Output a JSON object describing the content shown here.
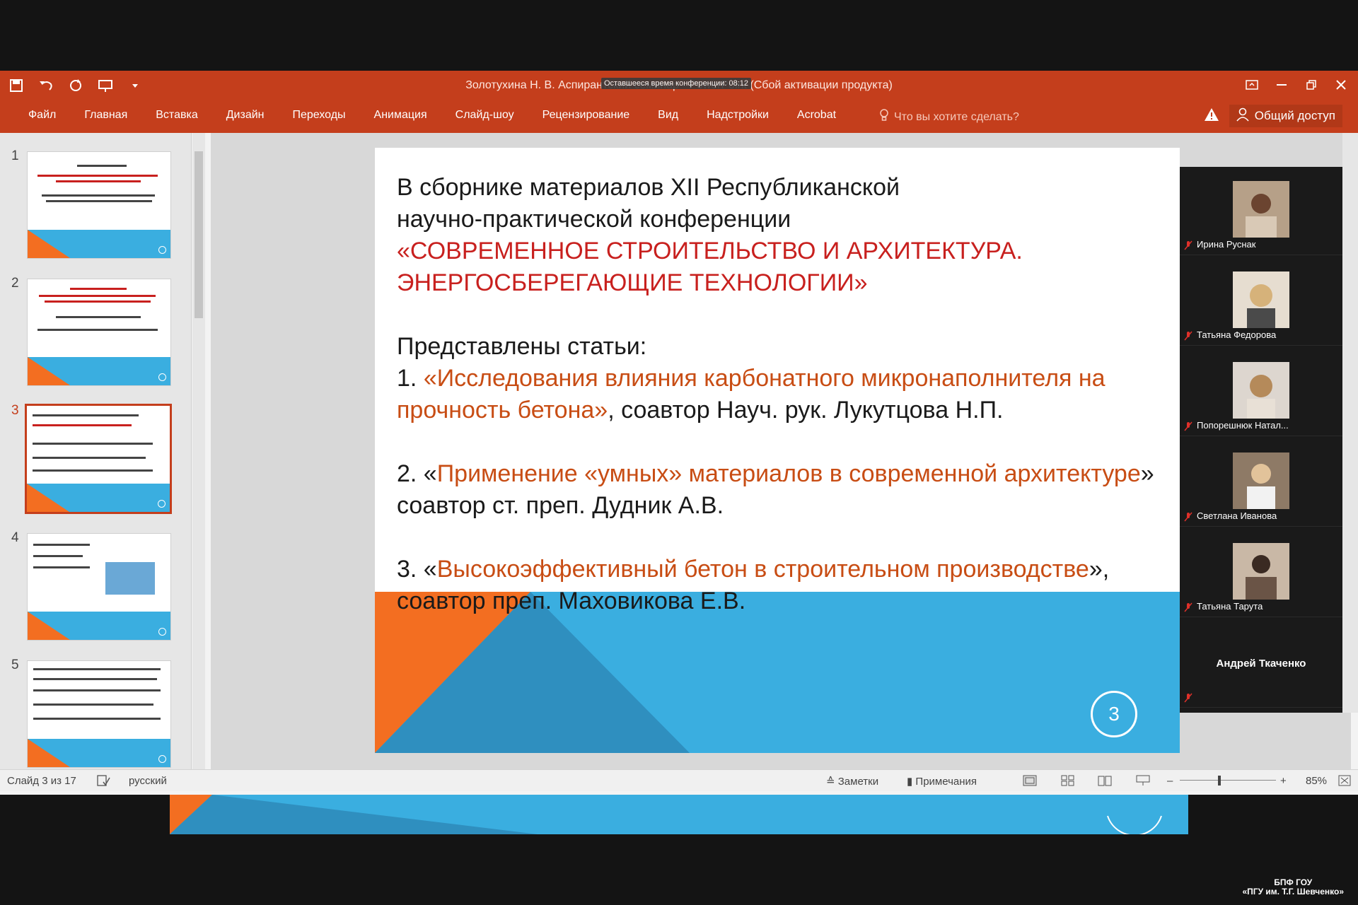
{
  "window": {
    "title": "Золотухина Н. В. Аспирантский семинар - PowerPoint (Сбой активации продукта)",
    "timer_tooltip": "Оставшееся время конференции: 08:12"
  },
  "ribbon": {
    "tabs": [
      "Файл",
      "Главная",
      "Вставка",
      "Дизайн",
      "Переходы",
      "Анимация",
      "Слайд-шоу",
      "Рецензирование",
      "Вид",
      "Надстройки",
      "Acrobat"
    ],
    "tell_me": "Что вы хотите сделать?",
    "share": "Общий доступ"
  },
  "thumbnails": [
    {
      "num": "1"
    },
    {
      "num": "2"
    },
    {
      "num": "3",
      "selected": true
    },
    {
      "num": "4"
    },
    {
      "num": "5"
    }
  ],
  "slide": {
    "line1": "В сборнике материалов XII Республиканской",
    "line2": "научно-практической конференции",
    "title_red1": "«СОВРЕМЕННОЕ СТРОИТЕЛЬСТВО И АРХИТЕКТУРА.",
    "title_red2": "ЭНЕРГОСБЕРЕГАЮЩИЕ ТЕХНОЛОГИИ»",
    "presented": "Представлены статьи:",
    "item1_num": "1. ",
    "item1_title": "«Исследования влияния карбонатного микронаполнителя на прочность бетона»",
    "item1_rest": ", соавтор Науч. рук. Лукутцова Н.П.",
    "item2_num": "2. «",
    "item2_title": "Применение «умных» материалов в современной архитектуре",
    "item2_rest": "» соавтор ст. преп. Дудник А.В.",
    "item3_num": "3. «",
    "item3_title": "Высокоэффективный бетон в строительном производстве",
    "item3_rest": "», соавтор  преп. Маховикова Е.В.",
    "number": "3"
  },
  "participants": [
    {
      "name": "Ирина Руснак"
    },
    {
      "name": "Татьяна Федорова"
    },
    {
      "name": "Попорешнюк Натал..."
    },
    {
      "name": "Светлана Иванова"
    },
    {
      "name": "Татьяна Тарута"
    },
    {
      "name": "Андрей Ткаченко"
    }
  ],
  "statusbar": {
    "slide_info": "Слайд 3 из 17",
    "language": "русский",
    "notes": "Заметки",
    "comments": "Примечания",
    "zoom": "85%"
  },
  "watermark": {
    "line1": "БПФ ГОУ",
    "line2": "«ПГУ им. Т.Г. Шевченко»"
  },
  "colors": {
    "accent": "#c43e1c",
    "slide_blue": "#3aaee0",
    "slide_orange": "#f36e21",
    "title_red": "#c8201e"
  }
}
